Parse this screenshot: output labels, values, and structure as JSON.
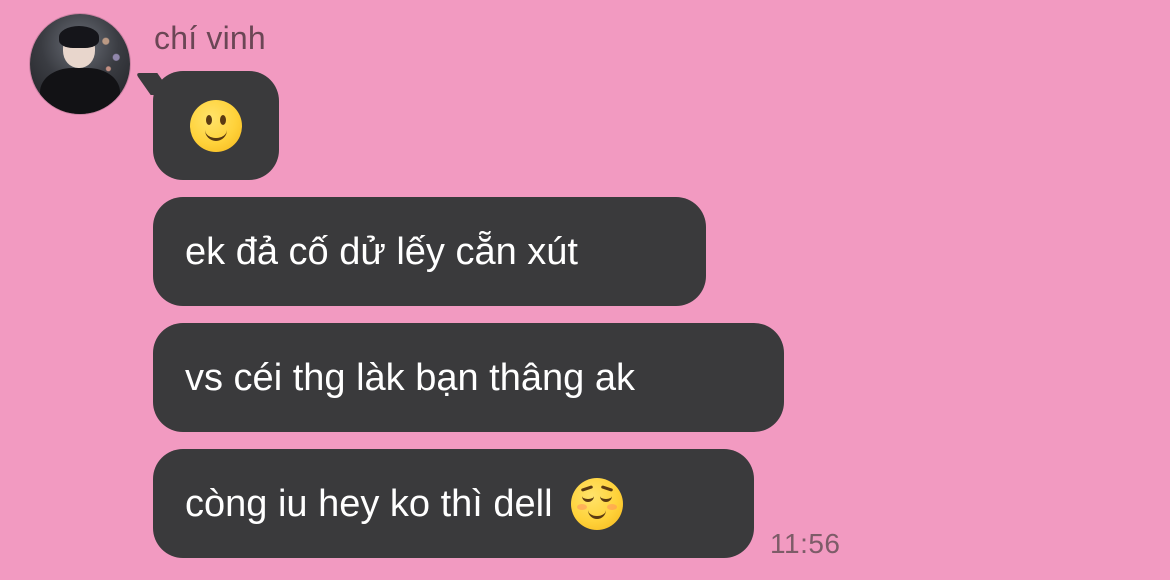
{
  "sender": {
    "name": "chí vinh",
    "avatar_icon": "profile-photo"
  },
  "messages": [
    {
      "type": "emoji",
      "emoji": "slightly-smiling-face-icon"
    },
    {
      "type": "text",
      "text": "ek đả cố dử lếy cẵn xút"
    },
    {
      "type": "text",
      "text": "vs céi thg làk bạn thâng ak"
    },
    {
      "type": "text",
      "text": "còng iu hey ko thì dell",
      "emoji": "relieved-face-icon"
    }
  ],
  "timestamp": "11:56",
  "colors": {
    "background": "#f29ac1",
    "bubble": "#3a3a3c",
    "bubble_text": "#ffffff",
    "name_text": "#6b4655",
    "timestamp_text": "#7d5c68"
  }
}
